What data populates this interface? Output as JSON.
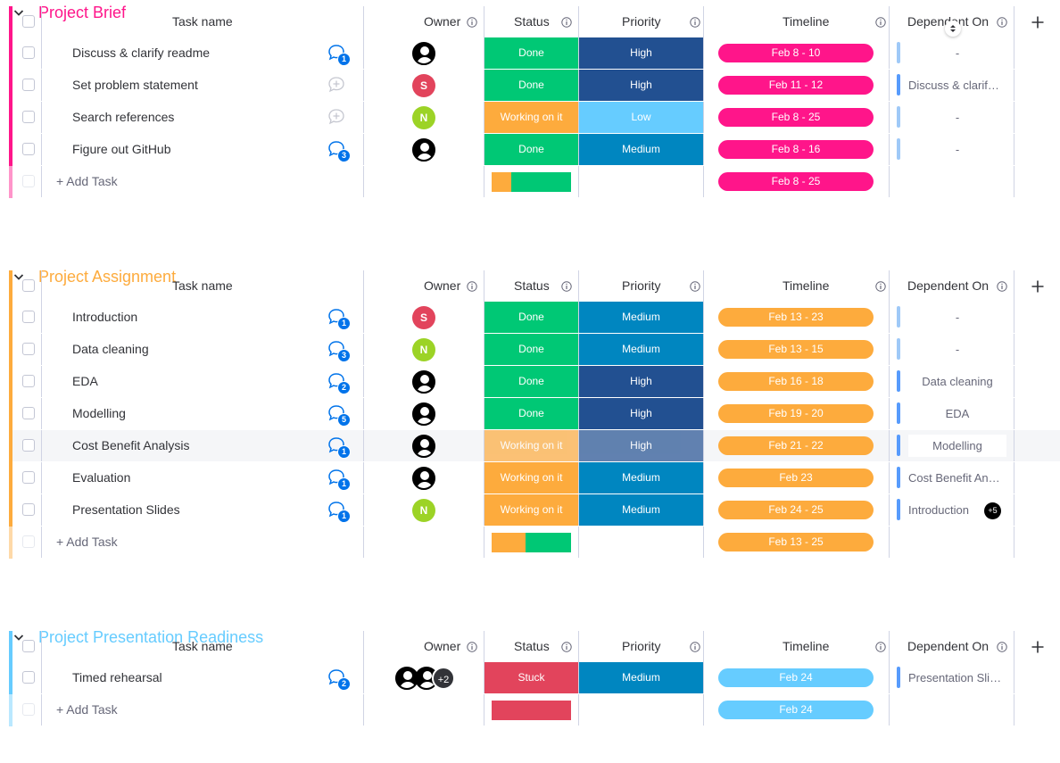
{
  "columns": {
    "task_name": "Task name",
    "owner": "Owner",
    "status": "Status",
    "priority": "Priority",
    "timeline": "Timeline",
    "dependent_on": "Dependent On"
  },
  "add_task_label": "+ Add Task",
  "colors": {
    "done": "#00c875",
    "working": "#fdab3d",
    "stuck": "#e2445c",
    "high": "#225091",
    "medium": "#0086c0",
    "low": "#66ccff",
    "brief_accent": "#ff158a",
    "assignment_accent": "#fdab3d",
    "presentation_accent": "#66ccff"
  },
  "groups": [
    {
      "title": "Project Brief",
      "color": "#ff158a",
      "tasks": [
        {
          "name": "Discuss & clarify readme",
          "updates": "1",
          "owner_type": "person",
          "owner_initial": "",
          "owner_color": "#000000",
          "status": "Done",
          "priority": "High",
          "timeline": "Feb 8 - 10",
          "dependent_on": "-"
        },
        {
          "name": "Set problem statement",
          "updates": "",
          "owner_type": "initial",
          "owner_initial": "S",
          "owner_color": "#e2445c",
          "status": "Done",
          "priority": "High",
          "timeline": "Feb 11 - 12",
          "dependent_on": "Discuss & clarify readme"
        },
        {
          "name": "Search references",
          "updates": "",
          "owner_type": "initial",
          "owner_initial": "N",
          "owner_color": "#9cd326",
          "status": "Working on it",
          "priority": "Low",
          "timeline": "Feb 8 - 25",
          "dependent_on": "-"
        },
        {
          "name": "Figure out GitHub",
          "updates": "3",
          "owner_type": "person",
          "owner_initial": "",
          "owner_color": "#000000",
          "status": "Done",
          "priority": "Medium",
          "timeline": "Feb 8 - 16",
          "dependent_on": "-"
        }
      ],
      "summary": {
        "timeline": "Feb 8 - 25",
        "status_distribution": [
          {
            "status": "Working on it",
            "fraction": 0.25
          },
          {
            "status": "Done",
            "fraction": 0.75
          }
        ]
      }
    },
    {
      "title": "Project Assignment",
      "color": "#fdab3d",
      "tasks": [
        {
          "name": "Introduction",
          "updates": "1",
          "owner_type": "initial",
          "owner_initial": "S",
          "owner_color": "#e2445c",
          "status": "Done",
          "priority": "Medium",
          "timeline": "Feb 13 - 23",
          "dependent_on": "-"
        },
        {
          "name": "Data cleaning",
          "updates": "3",
          "owner_type": "initial",
          "owner_initial": "N",
          "owner_color": "#9cd326",
          "status": "Done",
          "priority": "Medium",
          "timeline": "Feb 13 - 15",
          "dependent_on": "-"
        },
        {
          "name": "EDA",
          "updates": "2",
          "owner_type": "person",
          "owner_initial": "",
          "owner_color": "#000000",
          "status": "Done",
          "priority": "High",
          "timeline": "Feb 16 - 18",
          "dependent_on": "Data cleaning"
        },
        {
          "name": "Modelling",
          "updates": "5",
          "owner_type": "person",
          "owner_initial": "",
          "owner_color": "#000000",
          "status": "Done",
          "priority": "High",
          "timeline": "Feb 19 - 20",
          "dependent_on": "EDA"
        },
        {
          "name": "Cost Benefit Analysis",
          "updates": "1",
          "owner_type": "person",
          "owner_initial": "",
          "owner_color": "#000000",
          "status": "Working on it",
          "priority": "High",
          "timeline": "Feb 21 - 22",
          "dependent_on": "Modelling",
          "hover": true
        },
        {
          "name": "Evaluation",
          "updates": "1",
          "owner_type": "person",
          "owner_initial": "",
          "owner_color": "#000000",
          "status": "Working on it",
          "priority": "Medium",
          "timeline": "Feb 23",
          "dependent_on": "Cost Benefit Analysis"
        },
        {
          "name": "Presentation Slides",
          "updates": "1",
          "owner_type": "initial",
          "owner_initial": "N",
          "owner_color": "#9cd326",
          "status": "Working on it",
          "priority": "Medium",
          "timeline": "Feb 24 - 25",
          "dependent_on": "Introduction",
          "dependent_more": "+5"
        }
      ],
      "summary": {
        "timeline": "Feb 13 - 25",
        "status_distribution": [
          {
            "status": "Working on it",
            "fraction": 0.43
          },
          {
            "status": "Done",
            "fraction": 0.57
          }
        ]
      }
    },
    {
      "title": "Project Presentation Readiness",
      "color": "#66ccff",
      "tasks": [
        {
          "name": "Timed rehearsal",
          "updates": "2",
          "owner_type": "multi",
          "owner_initial": "",
          "owner_color": "#000000",
          "owner_more": "+2",
          "status": "Stuck",
          "priority": "Medium",
          "timeline": "Feb 24",
          "dependent_on": "Presentation Slides"
        }
      ],
      "summary": {
        "timeline": "Feb 24",
        "status_distribution": [
          {
            "status": "Stuck",
            "fraction": 1.0
          }
        ]
      }
    }
  ]
}
